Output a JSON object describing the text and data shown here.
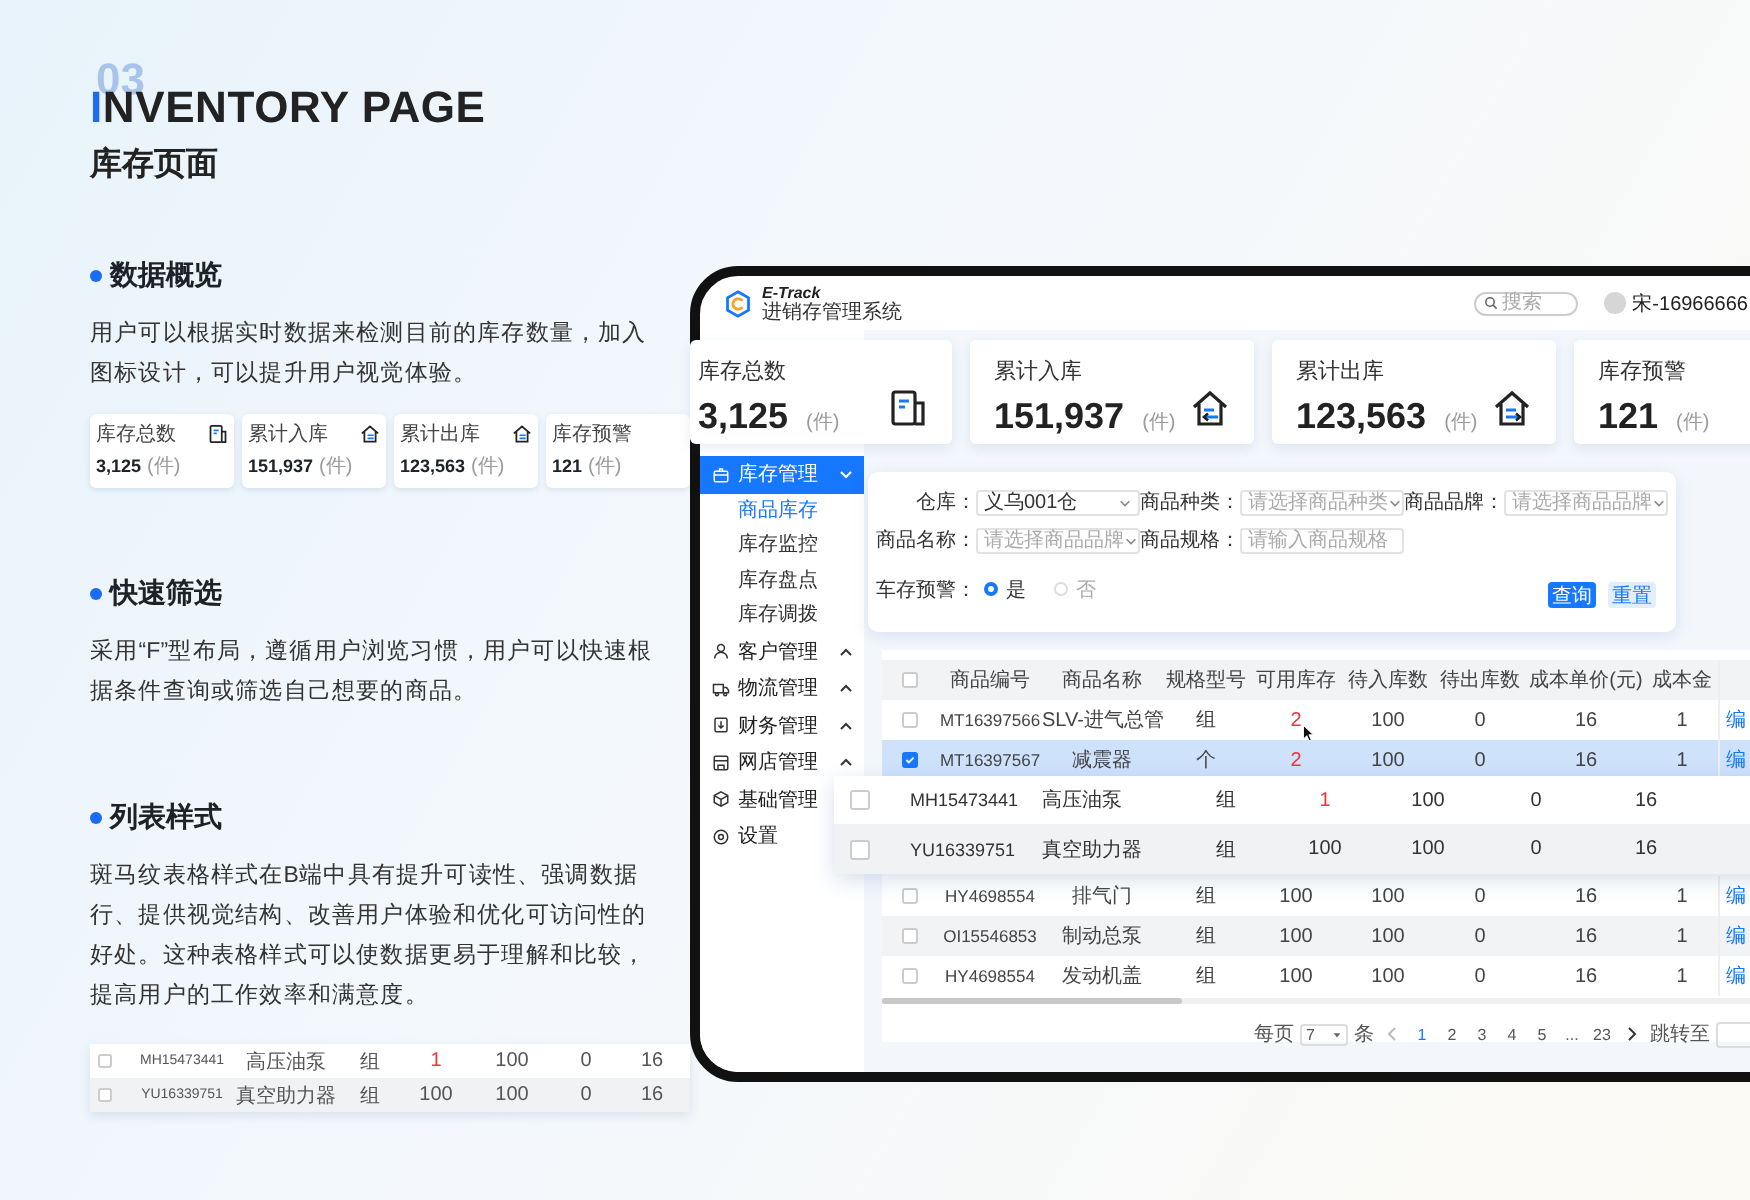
{
  "section_number": "03",
  "title": "INVENTORY PAGE",
  "subtitle": "库存页面",
  "sections": [
    {
      "heading": "数据概览",
      "text": "用户可以根据实时数据来检测目前的库存数量，加入图标设计，可以提升用户视觉体验。"
    },
    {
      "heading": "快速筛选",
      "text": "采用“F”型布局，遵循用户浏览习惯，用户可以快速根据条件查询或筛选自己想要的商品。"
    },
    {
      "heading": "列表样式",
      "text": "斑马纹表格样式在B端中具有提升可读性、强调数据行、提供视觉结构、改善用户体验和优化可访问性的好处。这种表格样式可以使数据更易于理解和比较，提高用户的工作效率和满意度。"
    }
  ],
  "mini_stats": [
    {
      "label": "库存总数",
      "value": "3,125",
      "unit": "(件)"
    },
    {
      "label": "累计入库",
      "value": "151,937",
      "unit": "(件)"
    },
    {
      "label": "累计出库",
      "value": "123,563",
      "unit": "(件)"
    },
    {
      "label": "库存预警",
      "value": "121",
      "unit": "(件)"
    }
  ],
  "mini_rows": [
    {
      "checked": false,
      "striped": false,
      "low_stock": true,
      "cells": [
        "MH15473441",
        "高压油泵",
        "组",
        "1",
        "100",
        "0",
        "16"
      ]
    },
    {
      "checked": false,
      "striped": true,
      "low_stock": false,
      "cells": [
        "YU16339751",
        "真空助力器",
        "组",
        "100",
        "100",
        "0",
        "16"
      ]
    }
  ],
  "app": {
    "brand": "E-Track",
    "brand_sub": "进销存管理系统",
    "search": {
      "placeholder": "搜索"
    },
    "user": "宋-16966666",
    "sidebar": [
      {
        "label": "库存管理",
        "kind": "group",
        "expanded": true,
        "selected": true,
        "children": [
          {
            "label": "商品库存",
            "selected": true
          },
          {
            "label": "库存监控",
            "selected": false
          },
          {
            "label": "库存盘点",
            "selected": false
          },
          {
            "label": "库存调拨",
            "selected": false
          }
        ]
      },
      {
        "label": "客户管理",
        "kind": "group",
        "expanded": false,
        "selected": false
      },
      {
        "label": "物流管理",
        "kind": "group",
        "expanded": false,
        "selected": false
      },
      {
        "label": "财务管理",
        "kind": "group",
        "expanded": false,
        "selected": false
      },
      {
        "label": "网店管理",
        "kind": "group",
        "expanded": false,
        "selected": false
      },
      {
        "label": "基础管理",
        "kind": "link",
        "selected": false
      },
      {
        "label": "设置",
        "kind": "link",
        "selected": false
      }
    ],
    "stats": [
      {
        "label": "库存总数",
        "value": "3,125",
        "unit": "(件)"
      },
      {
        "label": "累计入库",
        "value": "151,937",
        "unit": "(件)"
      },
      {
        "label": "累计出库",
        "value": "123,563",
        "unit": "(件)"
      },
      {
        "label": "库存预警",
        "value": "121",
        "unit": "(件)"
      }
    ],
    "filters": [
      {
        "label": "仓库：",
        "kind": "select",
        "value": "义乌001仓"
      },
      {
        "label": "商品种类：",
        "kind": "select",
        "placeholder": "请选择商品种类"
      },
      {
        "label": "商品品牌：",
        "kind": "select",
        "placeholder": "请选择商品品牌"
      },
      {
        "label": "商品名称：",
        "kind": "select",
        "placeholder": "请选择商品品牌"
      },
      {
        "label": "商品规格：",
        "kind": "input",
        "placeholder": "请输入商品规格"
      }
    ],
    "stock_alert": {
      "label": "车存预警：",
      "options": [
        {
          "label": "是",
          "selected": true
        },
        {
          "label": "否",
          "selected": false
        }
      ]
    },
    "buttons": [
      {
        "label": "查询",
        "kind": "primary"
      },
      {
        "label": "重置",
        "kind": "secondary"
      }
    ],
    "table": {
      "all_checked": false,
      "columns": [
        "商品编号",
        "商品名称",
        "规格型号",
        "可用库存",
        "待入库数",
        "待出库数",
        "成本单价(元)",
        "成本金"
      ],
      "rows": [
        {
          "checked": false,
          "selected": false,
          "striped": false,
          "low_stock": true,
          "cells": [
            "MT16397566",
            "SLV-进气总管",
            "组",
            "2",
            "100",
            "0",
            "16",
            "1"
          ],
          "action": "编"
        },
        {
          "checked": true,
          "selected": true,
          "striped": false,
          "low_stock": true,
          "cells": [
            "MT16397567",
            "减震器",
            "个",
            "2",
            "100",
            "0",
            "16",
            "1"
          ],
          "action": "编"
        },
        {
          "checked": false,
          "selected": false,
          "striped": false,
          "low_stock": false,
          "cells": [
            "HY4698554",
            "排气门",
            "组",
            "100",
            "100",
            "0",
            "16",
            "1"
          ],
          "action": "编"
        },
        {
          "checked": false,
          "selected": false,
          "striped": true,
          "low_stock": false,
          "cells": [
            "OI15546853",
            "制动总泵",
            "组",
            "100",
            "100",
            "0",
            "16",
            "1"
          ],
          "action": "编"
        },
        {
          "checked": false,
          "selected": false,
          "striped": false,
          "low_stock": false,
          "cells": [
            "HY4698554",
            "发动机盖",
            "组",
            "100",
            "100",
            "0",
            "16",
            "1"
          ],
          "action": "编"
        }
      ]
    },
    "zoomed_rows": [
      {
        "checked": false,
        "striped": false,
        "low_stock": true,
        "cells": [
          "MH15473441",
          "高压油泵",
          "组",
          "1",
          "100",
          "0",
          "16"
        ]
      },
      {
        "checked": false,
        "striped": true,
        "low_stock": false,
        "cells": [
          "YU16339751",
          "真空助力器",
          "组",
          "100",
          "100",
          "0",
          "16"
        ]
      }
    ],
    "pagination": {
      "size_label": "每页",
      "size": "7",
      "unit": "条",
      "pages": [
        {
          "label": "1",
          "selected": true
        },
        {
          "label": "2",
          "selected": false
        },
        {
          "label": "3",
          "selected": false
        },
        {
          "label": "4",
          "selected": false
        },
        {
          "label": "5",
          "selected": false
        },
        {
          "label": "...",
          "selected": false
        },
        {
          "label": "23",
          "selected": false
        }
      ],
      "jump_label": "跳转至"
    }
  }
}
